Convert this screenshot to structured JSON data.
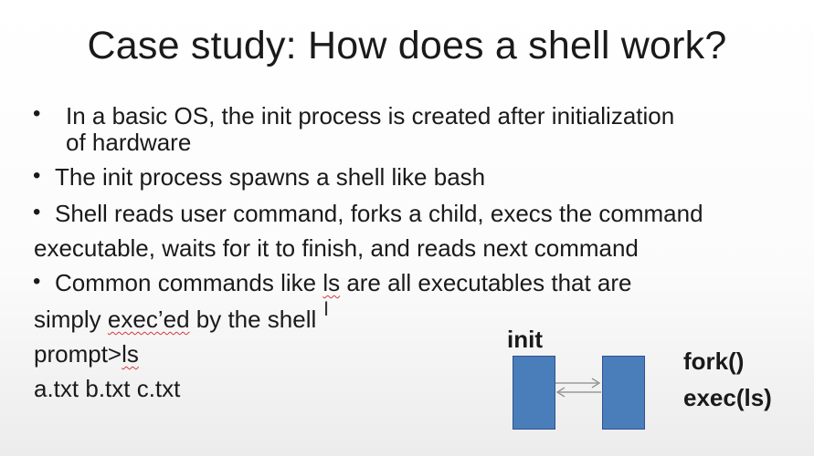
{
  "slide": {
    "title": "Case study: How does a shell work?",
    "bullet_char": "•",
    "b1_line1": "In a basic OS, the init process is created after initialization",
    "b1_line2": "of hardware",
    "b2": "The init process spawns a shell like bash",
    "b3_line1": "Shell reads user command, forks a child, execs the command",
    "b3_line2": "executable, waits for it to finish, and reads next command",
    "b4_line1_pre": "Common commands like ",
    "b4_line1_ls": "ls",
    "b4_line1_post": " are all executables that are",
    "b4_line2_pre": "simply ",
    "b4_line2_exec": "exec’ed",
    "b4_line2_post": " by the shell",
    "prompt_pre": "prompt>",
    "prompt_ls": "ls",
    "files": "a.txt b.txt c.txt"
  },
  "diagram": {
    "init_label": "init",
    "fork_label": "fork()",
    "exec_label": "exec(ls)"
  }
}
